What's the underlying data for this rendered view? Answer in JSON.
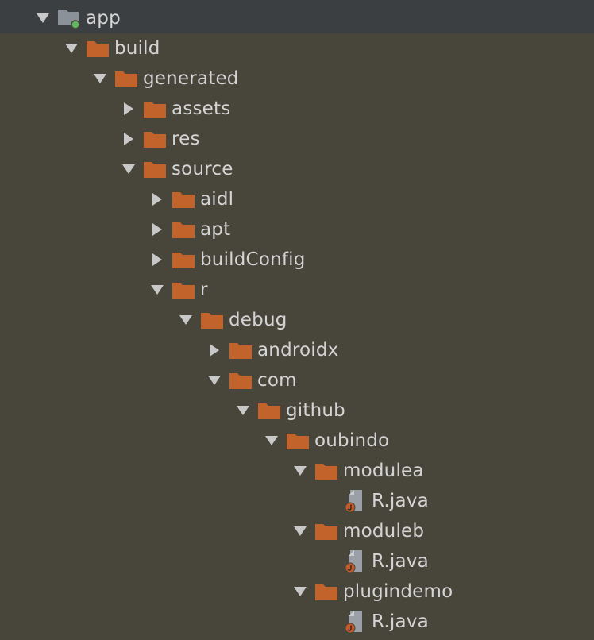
{
  "tree": [
    {
      "label": "app",
      "depth": 0,
      "arrow": "open",
      "icon": "module-folder-icon"
    },
    {
      "label": "build",
      "depth": 1,
      "arrow": "open",
      "icon": "folder-icon"
    },
    {
      "label": "generated",
      "depth": 2,
      "arrow": "open",
      "icon": "folder-icon"
    },
    {
      "label": "assets",
      "depth": 3,
      "arrow": "closed",
      "icon": "folder-icon"
    },
    {
      "label": "res",
      "depth": 3,
      "arrow": "closed",
      "icon": "folder-icon"
    },
    {
      "label": "source",
      "depth": 3,
      "arrow": "open",
      "icon": "folder-icon"
    },
    {
      "label": "aidl",
      "depth": 4,
      "arrow": "closed",
      "icon": "folder-icon"
    },
    {
      "label": "apt",
      "depth": 4,
      "arrow": "closed",
      "icon": "folder-icon"
    },
    {
      "label": "buildConfig",
      "depth": 4,
      "arrow": "closed",
      "icon": "folder-icon"
    },
    {
      "label": "r",
      "depth": 4,
      "arrow": "open",
      "icon": "folder-icon"
    },
    {
      "label": "debug",
      "depth": 5,
      "arrow": "open",
      "icon": "folder-icon"
    },
    {
      "label": "androidx",
      "depth": 6,
      "arrow": "closed",
      "icon": "folder-icon"
    },
    {
      "label": "com",
      "depth": 6,
      "arrow": "open",
      "icon": "folder-icon"
    },
    {
      "label": "github",
      "depth": 7,
      "arrow": "open",
      "icon": "folder-icon"
    },
    {
      "label": "oubindo",
      "depth": 8,
      "arrow": "open",
      "icon": "folder-icon"
    },
    {
      "label": "modulea",
      "depth": 9,
      "arrow": "open",
      "icon": "folder-icon"
    },
    {
      "label": "R.java",
      "depth": 10,
      "arrow": "none",
      "icon": "java-file-icon"
    },
    {
      "label": "moduleb",
      "depth": 9,
      "arrow": "open",
      "icon": "folder-icon"
    },
    {
      "label": "R.java",
      "depth": 10,
      "arrow": "none",
      "icon": "java-file-icon"
    },
    {
      "label": "plugindemo",
      "depth": 9,
      "arrow": "open",
      "icon": "folder-icon"
    },
    {
      "label": "R.java",
      "depth": 10,
      "arrow": "none",
      "icon": "java-file-icon"
    }
  ],
  "colors": {
    "background": "#48453a",
    "selected_row": "#3c3f41",
    "folder": "#c2632b",
    "arrow": "#c8c8c8",
    "text": "#d4d4d4",
    "module_badge": "#5fb85f",
    "module_folder": "#8a9199",
    "file_gray": "#9aa0a6",
    "java_badge": "#c4592a"
  }
}
